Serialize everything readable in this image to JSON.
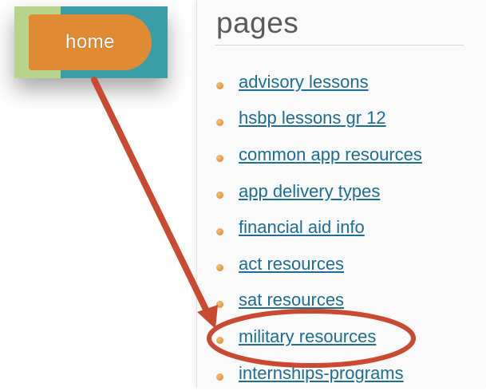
{
  "home_button": {
    "label": "home"
  },
  "panel": {
    "title": "pages",
    "items": [
      {
        "label": "advisory lessons"
      },
      {
        "label": "hsbp lessons gr 12"
      },
      {
        "label": "common app resources"
      },
      {
        "label": "app delivery types"
      },
      {
        "label": "financial aid info"
      },
      {
        "label": "act resources"
      },
      {
        "label": "sat resources"
      },
      {
        "label": "military resources",
        "highlighted": true
      },
      {
        "label": "internships-programs"
      }
    ]
  },
  "colors": {
    "home_button": "#e08a34",
    "home_teal": "#3b9ea7",
    "home_green": "#b7d48a",
    "link": "#1d6d97",
    "annotation": "#c94a30"
  },
  "annotation": {
    "arrow": {
      "from": "home-button",
      "to": "page-item-military-resources"
    },
    "circle": {
      "target": "page-item-military-resources"
    }
  }
}
